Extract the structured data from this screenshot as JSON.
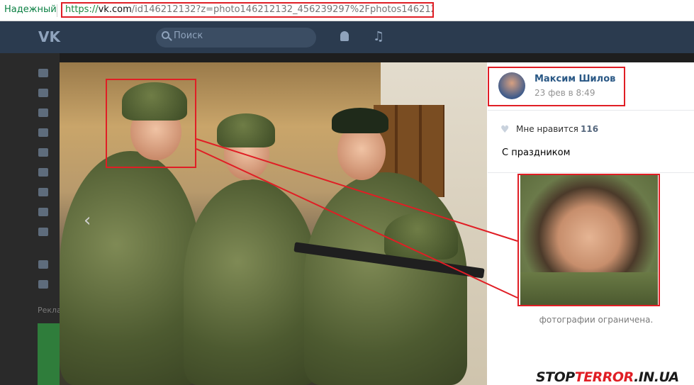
{
  "browser": {
    "secure_label": "Надежный",
    "url_scheme": "https://",
    "url_host": "vk.com",
    "url_rest": "/id146212132?z=photo146212132_456239297%2Fphotos146212132"
  },
  "vk_header": {
    "logo": "vk-logo",
    "search_placeholder": "Поиск"
  },
  "sidebar": {
    "promo_label": "Рекла"
  },
  "photo_post": {
    "author": "Максим Шилов",
    "date": "23 фев в 8:49",
    "likes_label": "Мне нравится",
    "likes_count": "116",
    "caption": "С праздником",
    "restricted_text": "фотографии ограничена."
  },
  "watermark": {
    "part1": "STOP",
    "part2": "TERROR",
    "part3": ".IN.UA"
  },
  "colors": {
    "highlight": "#e01e25",
    "vk_header": "#2b3b4f",
    "link": "#2a5885"
  }
}
